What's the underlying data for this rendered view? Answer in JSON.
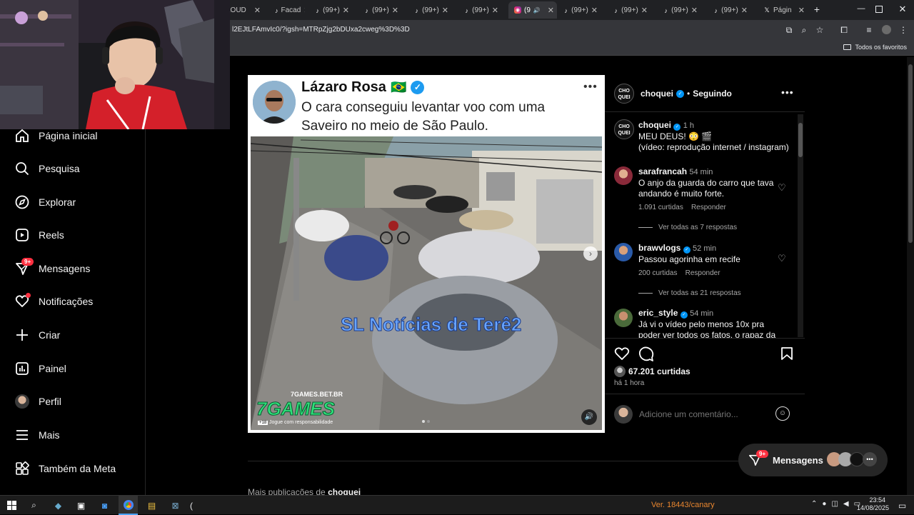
{
  "browser": {
    "tabs": [
      {
        "label": "LOUD",
        "icon": "loud-icon"
      },
      {
        "label": "Facad",
        "icon": "tiktok-icon"
      },
      {
        "label": "(99+)",
        "icon": "tiktok-icon"
      },
      {
        "label": "(99+)",
        "icon": "tiktok-icon"
      },
      {
        "label": "(99+)",
        "icon": "tiktok-icon"
      },
      {
        "label": "(99+)",
        "icon": "tiktok-icon"
      },
      {
        "label": "(9",
        "icon": "instagram-icon"
      },
      {
        "label": "(99+)",
        "icon": "tiktok-icon"
      },
      {
        "label": "(99+)",
        "icon": "tiktok-icon"
      },
      {
        "label": "(99+)",
        "icon": "tiktok-icon"
      },
      {
        "label": "(99+)",
        "icon": "tiktok-icon"
      },
      {
        "label": "Págin",
        "icon": "x-icon"
      }
    ],
    "url": "l2EJtLFAmvIc0/?igsh=MTRpZjg2bDUxa2cweg%3D%3D",
    "bookmarks_label": "Todos os favoritos"
  },
  "sidebar": {
    "items": [
      {
        "label": "Página inicial",
        "icon": "home-icon"
      },
      {
        "label": "Pesquisa",
        "icon": "search-icon"
      },
      {
        "label": "Explorar",
        "icon": "compass-icon"
      },
      {
        "label": "Reels",
        "icon": "reels-icon"
      },
      {
        "label": "Mensagens",
        "icon": "messenger-icon",
        "badge": "9+"
      },
      {
        "label": "Notificações",
        "icon": "heart-icon"
      },
      {
        "label": "Criar",
        "icon": "plus-icon"
      },
      {
        "label": "Painel",
        "icon": "dashboard-icon"
      },
      {
        "label": "Perfil",
        "icon": "profile-icon"
      },
      {
        "label": "Mais",
        "icon": "menu-icon"
      },
      {
        "label": "Também da Meta",
        "icon": "meta-icon"
      }
    ]
  },
  "media": {
    "tweet_author": "Lázaro Rosa",
    "tweet_flag": "🇧🇷",
    "tweet_text": "O cara conseguiu levantar voo com uma Saveiro no meio de São Paulo.",
    "watermark": "SL Notícias de Terê2",
    "sponsor": "7GAMES",
    "sponsor_url": "7GAMES.BET.BR",
    "sponsor_note": "Jogue com responsabilidade",
    "sponsor_rating": "+18"
  },
  "post": {
    "author": "choquei",
    "follow_status": "Seguindo",
    "separator": "•",
    "caption_author": "choquei",
    "caption_time": "1 h",
    "caption_line1": "MEU DEUS! 😳 🎬",
    "caption_line2": "(vídeo: reprodução internet / instagram)",
    "comments": [
      {
        "user": "sarafrancah",
        "time": "54 min",
        "text": "O anjo da guarda do carro que tava andando é muito forte.",
        "likes": "1.091 curtidas",
        "reply": "Responder",
        "view_replies": "Ver todas as 7 respostas"
      },
      {
        "user": "brawvlogs",
        "time": "52 min",
        "text": "Passou agorinha em recife",
        "likes": "200 curtidas",
        "reply": "Responder",
        "view_replies": "Ver todas as 21 respostas"
      },
      {
        "user": "eric_style",
        "time": "54 min",
        "text": "Já vi o vídeo pelo menos 10x pra poder ver todos os fatos, o rapaz da"
      }
    ],
    "likes": "67.201 curtidas",
    "posted": "há 1 hora",
    "comment_placeholder": "Adicione um comentário...",
    "more_from_prefix": "Mais publicações de",
    "more_from_user": "choquei"
  },
  "messages_pill": {
    "label": "Mensagens",
    "badge": "9+"
  },
  "taskbar": {
    "canary": "Ver. 18443/canary",
    "time": "23:54",
    "date": "14/08/2025"
  },
  "colors": {
    "accent": "#0095f6",
    "badge": "#ff3040",
    "verified": "#0095f6"
  }
}
